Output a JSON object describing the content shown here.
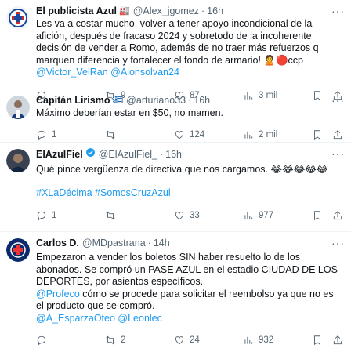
{
  "tweets": [
    {
      "name": "El publicista Azul",
      "name_emoji": "🏭",
      "handle": "@Alex_jgomez",
      "time": "16h",
      "body": "Les va a costar mucho, volver a tener apoyo incondicional de la afición, después de fracaso 2024 y sobretodo de la incoherente decisión de vender a Romo, además de no traer más refuerzos q marquen diferencia y fortalecer el fondo de armario! 🙎🔴ccp ",
      "mentions": "@Victor_VelRan @Alonsolvan24",
      "reply": "",
      "retweet": "9",
      "like": "87",
      "views": "3 mil"
    },
    {
      "name": "Capitán Lirismo",
      "name_emoji": "🇬🇷",
      "handle": "@arturiano33",
      "time": "16h",
      "body": "Máximo deberían estar en $50, no mamen.",
      "reply": "1",
      "retweet": "",
      "like": "124",
      "views": "2 mil"
    },
    {
      "name": "ElAzulFiel",
      "name_emoji": "",
      "handle": "@ElAzulFiel_",
      "time": "16h",
      "body": "Qué pince vergüenza de directiva que nos cargamos. 😂😂😂😂😂",
      "hashtags": "#XLaDécima #SomosCruzAzul",
      "reply": "1",
      "retweet": "",
      "like": "33",
      "views": "977"
    },
    {
      "name": "Carlos D.",
      "name_emoji": "",
      "handle": "@MDpastrana",
      "time": "14h",
      "body": "Empezaron a vender los boletos SIN haber resuelto lo de los abonados. Se compró un PASE AZUL en el estadio CIUDAD DE LOS DEPORTES, por asientos específicos.",
      "mention1": "@Profeco",
      "body2": " cómo se procede para solicitar el reembolso ya que no es el producto que se compró.",
      "mentions": "@A_EsparzaOteo @Leonlec",
      "reply": "",
      "retweet": "2",
      "like": "24",
      "views": "932"
    }
  ],
  "dot": "·",
  "more": "···"
}
